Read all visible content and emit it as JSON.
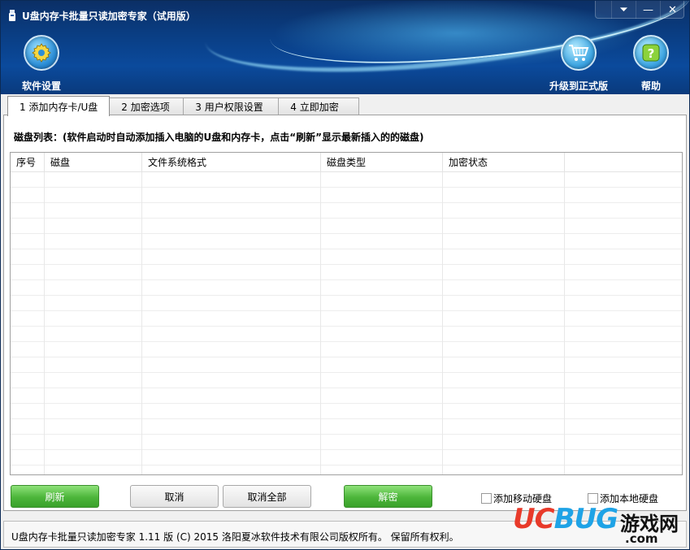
{
  "window": {
    "title": "U盘内存卡批量只读加密专家（试用版）",
    "controls": {
      "menu": "⏷",
      "minimize": "—",
      "close": "✕"
    }
  },
  "toolbar": {
    "settings_label": "软件设置",
    "upgrade_label": "升级到正式版",
    "help_label": "帮助",
    "icons": {
      "settings": "gear-icon",
      "upgrade": "shopping-cart-icon",
      "help": "question-icon"
    }
  },
  "tabs": [
    {
      "label": "1 添加内存卡/U盘",
      "active": true
    },
    {
      "label": "2 加密选项",
      "active": false
    },
    {
      "label": "3 用户权限设置",
      "active": false
    },
    {
      "label": "4 立即加密",
      "active": false
    }
  ],
  "panel": {
    "disk_list_label": "磁盘列表：(软件启动时自动添加插入电脑的U盘和内存卡，点击“刷新”显示最新插入的的磁盘)"
  },
  "table": {
    "columns": [
      "序号",
      "磁盘",
      "文件系统格式",
      "磁盘类型",
      "加密状态",
      ""
    ],
    "rows": []
  },
  "buttons": {
    "refresh": "刷新",
    "cancel": "取消",
    "cancel_all": "取消全部",
    "decrypt": "解密"
  },
  "checkboxes": {
    "add_removable_hdd": {
      "label": "添加移动硬盘",
      "checked": false
    },
    "add_local_hdd": {
      "label": "添加本地硬盘",
      "checked": false
    }
  },
  "status_bar": {
    "text": "U盘内存卡批量只读加密专家 1.11 版 (C) 2015 洛阳夏冰软件技术有限公司版权所有。 保留所有权利。"
  },
  "watermark": {
    "brand_uc": "UC",
    "brand_bug": "BUG",
    "cn": "游戏网",
    "domain": ".com"
  },
  "colors": {
    "header_dark": "#0b2f66",
    "header_light": "#0b4a9c",
    "green_button": "#4cb53a",
    "watermark_red": "#e83a2a",
    "watermark_blue": "#1fa3e6"
  }
}
